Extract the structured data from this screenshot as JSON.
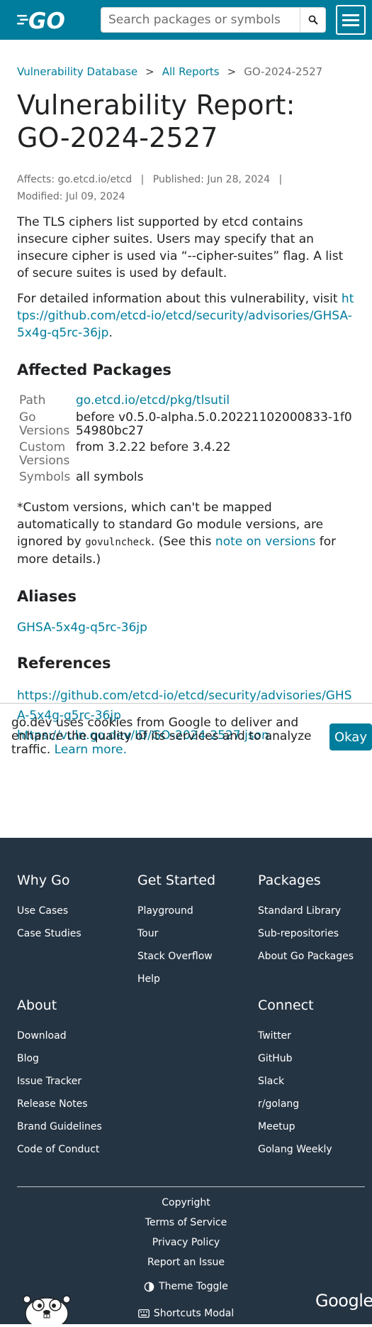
{
  "header": {
    "logo_text": "GO",
    "search_placeholder": "Search packages or symbols",
    "search_icon": "search-icon",
    "menu_icon": "hamburger-menu-icon"
  },
  "breadcrumb": {
    "items": [
      "Vulnerability Database",
      "All Reports"
    ],
    "current": "GO-2024-2527",
    "separator": ">"
  },
  "report": {
    "title": "Vulnerability Report: GO-2024-2527",
    "affects_label": "Affects:",
    "affects_value": "go.etcd.io/etcd",
    "published": "Published: Jun 28, 2024",
    "modified": "Modified: Jul 09, 2024",
    "summary": "The TLS ciphers list supported by etcd contains insecure cipher suites. Users may specify that an insecure cipher is used via “--cipher-suites” flag. A list of secure suites is used by default.",
    "detail_prefix": "For detailed information about this vulnerability, visit ",
    "detail_link": "https://github.com/etcd-io/etcd/security/advisories/GHSA-5x4g-q5rc-36jp",
    "detail_suffix": "."
  },
  "affected": {
    "heading": "Affected Packages",
    "rows": [
      {
        "key": "Path",
        "value": "go.etcd.io/etcd/pkg/tlsutil"
      },
      {
        "key": "Go Versions",
        "value": "before v0.5.0-alpha.5.0.20221102000833-1f054980bc27"
      },
      {
        "key": "Custom Versions",
        "value": "from 3.2.22 before 3.4.22"
      },
      {
        "key": "Symbols",
        "value": "all symbols"
      }
    ],
    "note_prefix": "*Custom versions, which can't be mapped automatically to standard Go module versions, are ignored by ",
    "note_code": "govulncheck",
    "note_mid": ". (See this ",
    "note_link": "note on versions",
    "note_suffix": " for more details.)"
  },
  "aliases": {
    "heading": "Aliases",
    "items": [
      "GHSA-5x4g-q5rc-36jp"
    ]
  },
  "references": {
    "heading": "References",
    "items": [
      "https://github.com/etcd-io/etcd/security/advisories/GHSA-5x4g-q5rc-36jp",
      "https://vuln.go.dev/ID/GO-2024-2527.json"
    ]
  },
  "cookie": {
    "text": "go.dev uses cookies from Google to deliver and enhance the quality of its services and to analyze traffic. ",
    "link": "Learn more.",
    "button": "Okay"
  },
  "footer": {
    "columns": [
      {
        "heading": "Why Go",
        "items": [
          "Use Cases",
          "Case Studies"
        ]
      },
      {
        "heading": "Get Started",
        "items": [
          "Playground",
          "Tour",
          "Stack Overflow",
          "Help"
        ]
      },
      {
        "heading": "Packages",
        "items": [
          "Standard Library",
          "Sub-repositories",
          "About Go Packages"
        ]
      },
      {
        "heading": "About",
        "items": [
          "Download",
          "Blog",
          "Issue Tracker",
          "Release Notes",
          "Brand Guidelines",
          "Code of Conduct"
        ]
      },
      {
        "heading": "Connect",
        "items": [
          "Twitter",
          "GitHub",
          "Slack",
          "r/golang",
          "Meetup",
          "Golang Weekly"
        ]
      }
    ],
    "links": [
      "Copyright",
      "Terms of Service",
      "Privacy Policy",
      "Report an Issue"
    ],
    "theme_toggle": "Theme Toggle",
    "shortcuts": "Shortcuts Modal",
    "google": "Google"
  },
  "colors": {
    "brand": "#007d9c",
    "footer_bg": "#253443"
  }
}
